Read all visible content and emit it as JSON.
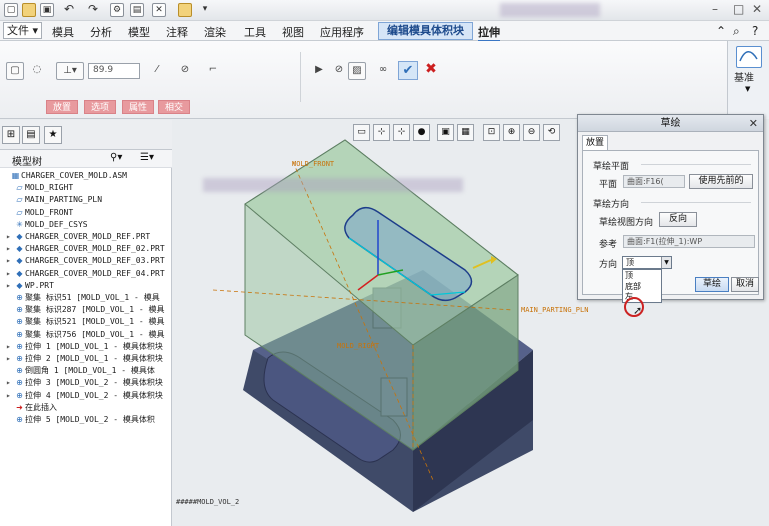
{
  "menubar": {
    "file": "文件",
    "items": [
      "模具",
      "分析",
      "模型",
      "注释",
      "渲染",
      "工具",
      "视图",
      "应用程序"
    ],
    "active_tab": "编辑模具体积块",
    "extrude_tab": "拉伸"
  },
  "ribbon": {
    "depth_value": "89.9",
    "subtabs": [
      "放置",
      "选项",
      "属性",
      "相交"
    ]
  },
  "datum": {
    "label": "基准"
  },
  "model_tree": {
    "title": "模型树",
    "items": [
      {
        "text": "CHARGER_COVER_MOLD.ASM",
        "icon": "▦",
        "exp": ""
      },
      {
        "text": "MOLD_RIGHT",
        "icon": "▱",
        "exp": ""
      },
      {
        "text": "MAIN_PARTING_PLN",
        "icon": "▱",
        "exp": ""
      },
      {
        "text": "MOLD_FRONT",
        "icon": "▱",
        "exp": ""
      },
      {
        "text": "MOLD_DEF_CSYS",
        "icon": "✳",
        "exp": ""
      },
      {
        "text": "CHARGER_COVER_MOLD_REF.PRT",
        "icon": "◆",
        "exp": "▸"
      },
      {
        "text": "CHARGER_COVER_MOLD_REF_02.PRT",
        "icon": "◆",
        "exp": "▸"
      },
      {
        "text": "CHARGER_COVER_MOLD_REF_03.PRT",
        "icon": "◆",
        "exp": "▸"
      },
      {
        "text": "CHARGER_COVER_MOLD_REF_04.PRT",
        "icon": "◆",
        "exp": "▸"
      },
      {
        "text": "WP.PRT",
        "icon": "◆",
        "exp": "▸"
      },
      {
        "text": "聚集 标识51 [MOLD_VOL_1 - 模具",
        "icon": "⊕",
        "exp": ""
      },
      {
        "text": "聚集 标识287 [MOLD_VOL_1 - 模具",
        "icon": "⊕",
        "exp": ""
      },
      {
        "text": "聚集 标识521 [MOLD_VOL_1 - 模具",
        "icon": "⊕",
        "exp": ""
      },
      {
        "text": "聚集 标识756 [MOLD_VOL_1 - 模具",
        "icon": "⊕",
        "exp": ""
      },
      {
        "text": "拉伸 1 [MOLD_VOL_1 - 模具体积块",
        "icon": "⊕",
        "exp": "▸"
      },
      {
        "text": "拉伸 2 [MOLD_VOL_1 - 模具体积块",
        "icon": "⊕",
        "exp": "▸"
      },
      {
        "text": "倒圆角 1 [MOLD_VOL_1 - 模具体",
        "icon": "⊕",
        "exp": ""
      },
      {
        "text": "拉伸 3 [MOLD_VOL_2 - 模具体积块",
        "icon": "⊕",
        "exp": "▸"
      },
      {
        "text": "拉伸 4 [MOLD_VOL_2 - 模具体积块",
        "icon": "⊕",
        "exp": "▸"
      },
      {
        "text": "在此插入",
        "icon": "➜",
        "exp": ""
      },
      {
        "text": "拉伸 5 [MOLD_VOL_2 - 模具体积",
        "icon": "⊕",
        "exp": ""
      }
    ]
  },
  "graphics": {
    "labels": {
      "mold_front": "MOLD_FRONT",
      "main_parting": "MAIN_PARTING_PLN",
      "mold_right": "MOLD_RIGHT"
    },
    "status": "#####MOLD_VOL_2"
  },
  "sketch_dialog": {
    "title": "草绘",
    "tab": "放置",
    "plane_section": "草绘平面",
    "plane_label": "平面",
    "plane_value": "曲面:F16(",
    "use_previous": "使用先前的",
    "orient_section": "草绘方向",
    "view_dir_label": "草绘视图方向",
    "flip": "反向",
    "ref_label": "参考",
    "ref_value": "曲面:F1(拉伸_1):WP",
    "dir_label": "方向",
    "dir_value": "顶",
    "dir_options": [
      "顶",
      "底部",
      "左"
    ],
    "sketch_btn": "草绘",
    "cancel_btn": "取消"
  },
  "colors": {
    "accent": "#3a76c4",
    "cancel": "#cc1f1f",
    "mold_green": "#7fa886",
    "part_blue": "#3f4a68"
  }
}
